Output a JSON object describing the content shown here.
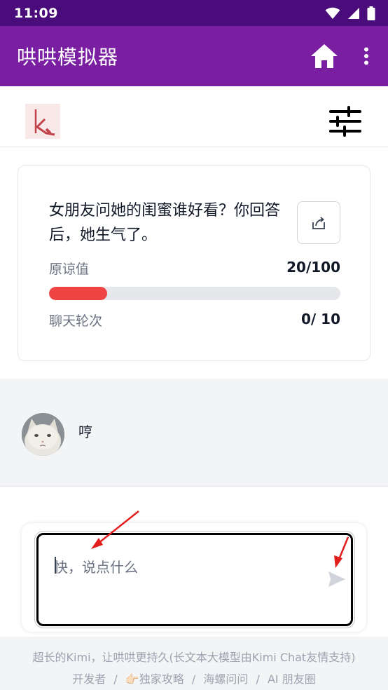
{
  "status_bar": {
    "time": "11:09"
  },
  "app_bar": {
    "title": "哄哄模拟器"
  },
  "card": {
    "question": "女朋友问她的闺蜜谁好看？你回答后，她生气了。",
    "forgiveness_label": "原谅值",
    "forgiveness_value": "20/100",
    "forgiveness_fraction": 0.2,
    "rounds_label": "聊天轮次",
    "rounds_value": "0/ 10"
  },
  "chat": {
    "message": "哼"
  },
  "input": {
    "placeholder": "快，说点什么"
  },
  "footer": {
    "line1": "超长的Kimi，让哄哄更持久(长文本大模型由Kimi Chat友情支持)",
    "links": [
      "开发者",
      "👉🏻独家攻略",
      "海螺问问",
      "AI 朋友圈"
    ],
    "separator": "/"
  },
  "colors": {
    "status_bar": "#4a0c7a",
    "app_bar": "#7a1fa2",
    "progress_fill": "#ef4444",
    "annotation_arrow": "#e11d1d"
  }
}
